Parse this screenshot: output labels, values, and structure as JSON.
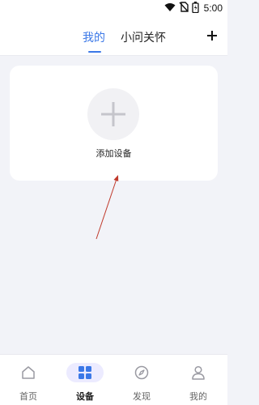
{
  "status_bar": {
    "time": "5:00",
    "icons": [
      "wifi-icon",
      "no-sim-icon",
      "battery-icon"
    ]
  },
  "header": {
    "tabs": [
      {
        "label": "我的",
        "active": true
      },
      {
        "label": "小问关怀",
        "active": false
      }
    ],
    "add_icon": "plus-icon"
  },
  "card": {
    "add_label": "添加设备",
    "add_icon": "plus-icon"
  },
  "bottom_nav": {
    "items": [
      {
        "label": "首页",
        "icon": "home-icon",
        "active": false
      },
      {
        "label": "设备",
        "icon": "grid-icon",
        "active": true
      },
      {
        "label": "发现",
        "icon": "compass-icon",
        "active": false
      },
      {
        "label": "我的",
        "icon": "person-icon",
        "active": false
      }
    ]
  },
  "colors": {
    "accent": "#3b78e7",
    "background": "#f2f3f8",
    "card": "#ffffff",
    "annotation_arrow": "#c0392b"
  }
}
